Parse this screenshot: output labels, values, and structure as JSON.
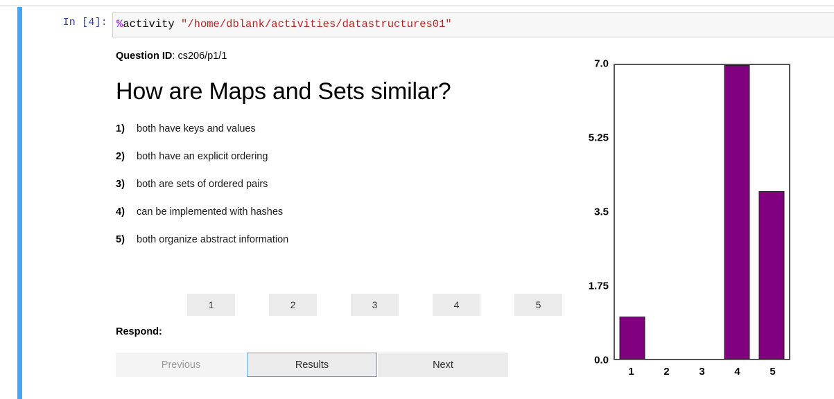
{
  "notebook": {
    "input_prompt": "In [4]:",
    "code": {
      "magic_symbol": "%",
      "magic_name": "activity",
      "space": " ",
      "argument": "\"/home/dblank/activities/datastructures01\""
    }
  },
  "activity": {
    "question_id_label": "Question ID",
    "question_id_separator": ": ",
    "question_id_value": "cs206/p1/1",
    "question_title": "How are Maps and Sets similar?",
    "options": [
      {
        "number": "1)",
        "text": "both have keys and values"
      },
      {
        "number": "2)",
        "text": "both have an explicit ordering"
      },
      {
        "number": "3)",
        "text": "both are sets of ordered pairs"
      },
      {
        "number": "4)",
        "text": "can be implemented with hashes"
      },
      {
        "number": "5)",
        "text": "both organize abstract information"
      }
    ],
    "answer_buttons": [
      "1",
      "2",
      "3",
      "4",
      "5"
    ],
    "respond_label": "Respond:",
    "nav_buttons": {
      "previous": "Previous",
      "results": "Results",
      "next": "Next"
    }
  },
  "colors": {
    "cell_selection_bar": "#42a5f5",
    "bar_fill": "#800080",
    "focus_border": "#5ba4e0",
    "button_bg": "#ebebeb",
    "magic_symbol": "#AA22FF",
    "string_literal": "#BA2121",
    "prompt_text": "#303F9F"
  },
  "chart_data": {
    "type": "bar",
    "title": "",
    "xlabel": "",
    "ylabel": "",
    "categories": [
      "1",
      "2",
      "3",
      "4",
      "5"
    ],
    "values": [
      1,
      0,
      0,
      7,
      4
    ],
    "ylim": [
      0,
      7
    ],
    "yticks": [
      "0.0",
      "1.75",
      "3.5",
      "5.25",
      "7.0"
    ],
    "ytick_values": [
      0,
      1.75,
      3.5,
      5.25,
      7
    ],
    "grid": false,
    "legend": false,
    "bar_color": "#800080"
  }
}
